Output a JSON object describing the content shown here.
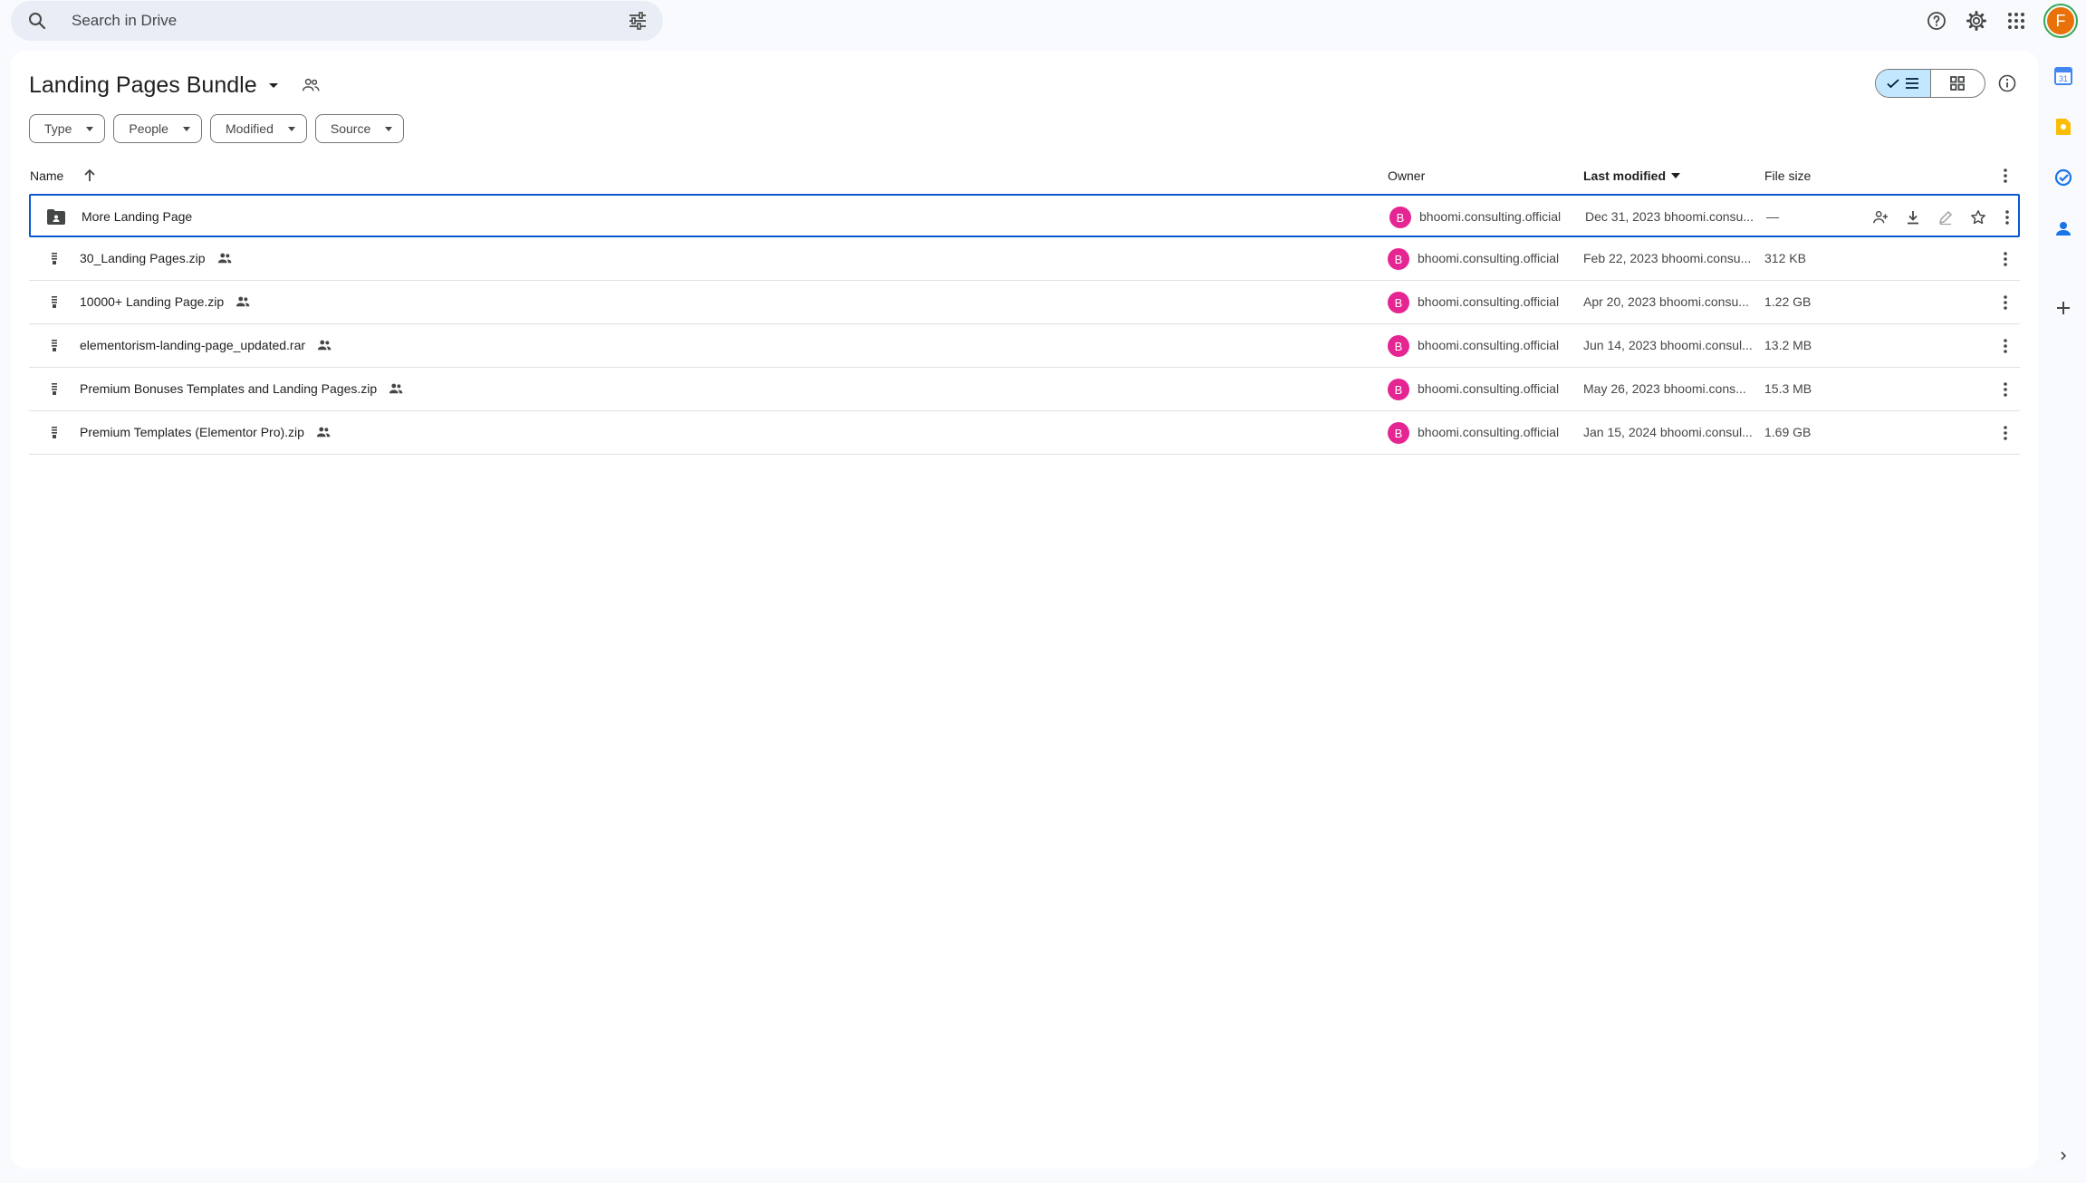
{
  "search": {
    "placeholder": "Search in Drive"
  },
  "header": {
    "help_icon": "help-icon",
    "settings_icon": "gear-icon",
    "apps_icon": "apps-grid-icon",
    "account_initial": "F"
  },
  "folder": {
    "title": "Landing Pages Bundle"
  },
  "filters": [
    {
      "label": "Type"
    },
    {
      "label": "People"
    },
    {
      "label": "Modified"
    },
    {
      "label": "Source"
    }
  ],
  "columns": {
    "name": "Name",
    "owner": "Owner",
    "last_modified": "Last modified",
    "file_size": "File size"
  },
  "files": [
    {
      "name": "More Landing Page",
      "kind": "shared-folder",
      "shared": false,
      "owner_initial": "B",
      "owner": "bhoomi.consulting.official",
      "modified": "Dec 31, 2023 bhoomi.consu...",
      "size": "—",
      "selected": true
    },
    {
      "name": "30_Landing Pages.zip",
      "kind": "zip",
      "shared": true,
      "owner_initial": "B",
      "owner": "bhoomi.consulting.official",
      "modified": "Feb 22, 2023 bhoomi.consu...",
      "size": "312 KB",
      "selected": false
    },
    {
      "name": "10000+ Landing Page.zip",
      "kind": "zip",
      "shared": true,
      "owner_initial": "B",
      "owner": "bhoomi.consulting.official",
      "modified": "Apr 20, 2023 bhoomi.consu...",
      "size": "1.22 GB",
      "selected": false
    },
    {
      "name": "elementorism-landing-page_updated.rar",
      "kind": "zip",
      "shared": true,
      "owner_initial": "B",
      "owner": "bhoomi.consulting.official",
      "modified": "Jun 14, 2023 bhoomi.consul...",
      "size": "13.2 MB",
      "selected": false
    },
    {
      "name": "Premium Bonuses Templates and Landing Pages.zip",
      "kind": "zip",
      "shared": true,
      "owner_initial": "B",
      "owner": "bhoomi.consulting.official",
      "modified": "May 26, 2023 bhoomi.cons...",
      "size": "15.3 MB",
      "selected": false
    },
    {
      "name": "Premium Templates (Elementor Pro).zip",
      "kind": "zip",
      "shared": true,
      "owner_initial": "B",
      "owner": "bhoomi.consulting.official",
      "modified": "Jan 15, 2024 bhoomi.consul...",
      "size": "1.69 GB",
      "selected": false
    }
  ],
  "colors": {
    "accent": "#0b57d0",
    "owner_avatar": "#e52592",
    "account_avatar": "#e8710a",
    "toggle_active": "#c2e7ff"
  }
}
